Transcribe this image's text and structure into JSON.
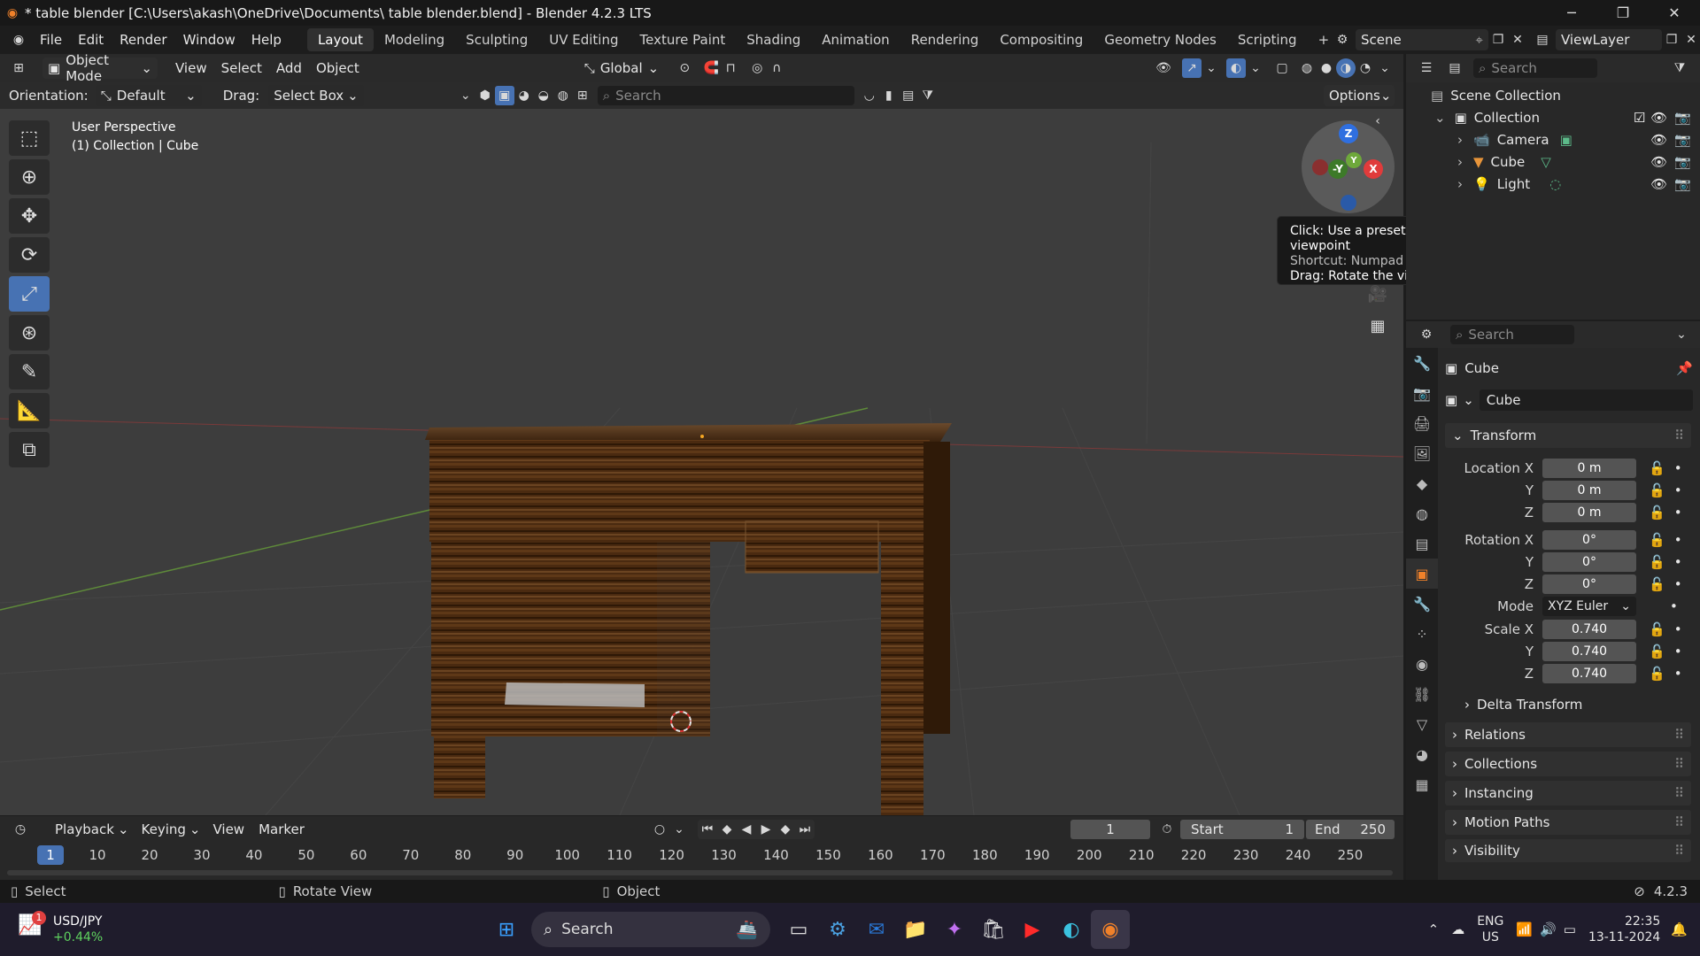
{
  "titlebar": {
    "title": "* table blender [C:\\Users\\akash\\OneDrive\\Documents\\ table blender.blend] - Blender 4.2.3 LTS",
    "minimize": "─",
    "maximize": "❐",
    "close": "✕"
  },
  "menubar": {
    "menus": [
      "File",
      "Edit",
      "Render",
      "Window",
      "Help"
    ],
    "workspaces": [
      "Layout",
      "Modeling",
      "Sculpting",
      "UV Editing",
      "Texture Paint",
      "Shading",
      "Animation",
      "Rendering",
      "Compositing",
      "Geometry Nodes",
      "Scripting"
    ],
    "active_workspace": "Layout",
    "add_workspace": "+",
    "scene": "Scene",
    "view_layer": "ViewLayer"
  },
  "viewport": {
    "header": {
      "mode": "Object Mode",
      "menus": [
        "View",
        "Select",
        "Add",
        "Object"
      ],
      "transform_orientation": "Global"
    },
    "subheader": {
      "orientation_label": "Orientation:",
      "orientation_value": "Default",
      "drag_label": "Drag:",
      "drag_value": "Select Box",
      "search_placeholder": "Search",
      "options": "Options"
    },
    "overlay": {
      "perspective": "User Perspective",
      "collection_info": "(1) Collection | Cube"
    },
    "gizmo": {
      "z": "Z",
      "y": "Y",
      "x": "X",
      "neg_y": "-Y"
    },
    "tooltip": {
      "line1": "Click: Use a preset viewpoint",
      "line2": "Shortcut: Numpad 1",
      "line3": "Drag: Rotate the view"
    }
  },
  "outliner": {
    "search_placeholder": "Search",
    "root": "Scene Collection",
    "collection": "Collection",
    "items": [
      {
        "name": "Camera",
        "icon": "camera-icon"
      },
      {
        "name": "Cube",
        "icon": "mesh-icon"
      },
      {
        "name": "Light",
        "icon": "light-icon"
      }
    ]
  },
  "properties": {
    "search_placeholder": "Search",
    "object_name": "Cube",
    "object_field": "Cube",
    "transform_label": "Transform",
    "location": {
      "label": "Location X",
      "x": "0 m",
      "y": "0 m",
      "z": "0 m"
    },
    "rotation": {
      "label": "Rotation X",
      "x": "0°",
      "y": "0°",
      "z": "0°"
    },
    "mode": {
      "label": "Mode",
      "value": "XYZ Euler"
    },
    "scale": {
      "label": "Scale X",
      "x": "0.740",
      "y": "0.740",
      "z": "0.740"
    },
    "axis_y": "Y",
    "axis_z": "Z",
    "delta_transform": "Delta Transform",
    "panels": [
      "Relations",
      "Collections",
      "Instancing",
      "Motion Paths",
      "Visibility"
    ]
  },
  "timeline": {
    "menus": [
      "Playback",
      "Keying",
      "View",
      "Marker"
    ],
    "current_frame": "1",
    "start_label": "Start",
    "start": "1",
    "end_label": "End",
    "end": "250",
    "ruler": [
      "1",
      "10",
      "20",
      "30",
      "40",
      "50",
      "60",
      "70",
      "80",
      "90",
      "100",
      "110",
      "120",
      "130",
      "140",
      "150",
      "160",
      "170",
      "180",
      "190",
      "200",
      "210",
      "220",
      "230",
      "240",
      "250"
    ]
  },
  "statusbar": {
    "select": "Select",
    "rotate": "Rotate View",
    "object": "Object",
    "version": "4.2.3"
  },
  "taskbar": {
    "widget_title": "USD/JPY",
    "widget_value": "+0.44%",
    "widget_badge": "1",
    "search": "Search",
    "lang": "ENG",
    "region": "US",
    "time": "22:35",
    "date": "13-11-2024"
  }
}
